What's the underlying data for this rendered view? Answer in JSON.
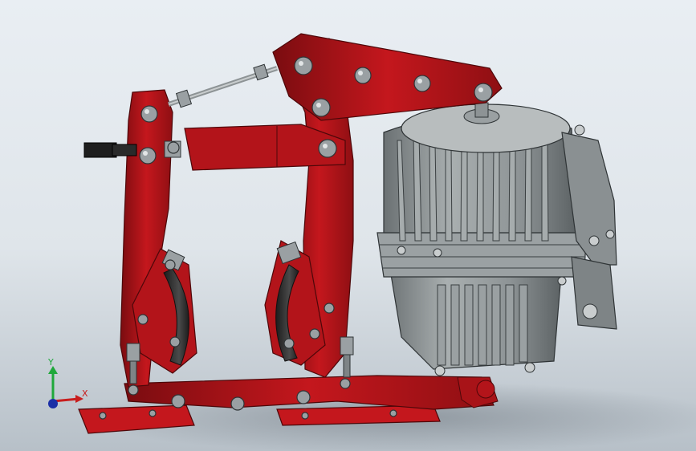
{
  "viewport": {
    "background_top": "#e9eef3",
    "background_bottom": "#b7c0c8"
  },
  "model": {
    "frame_color": "#b3141a",
    "frame_dark": "#6f0b0e",
    "frame_light": "#d9262c",
    "motor_color": "#8c9294",
    "motor_dark": "#4f5557",
    "motor_light": "#bfc4c5",
    "bolt_color": "#9aa0a3",
    "shoe_color": "#2a2a2a"
  },
  "triad": {
    "x_label": "X",
    "y_label": "Y",
    "x_color": "#c81e1e",
    "y_color": "#1fa83a",
    "z_color": "#1b2fa6"
  }
}
